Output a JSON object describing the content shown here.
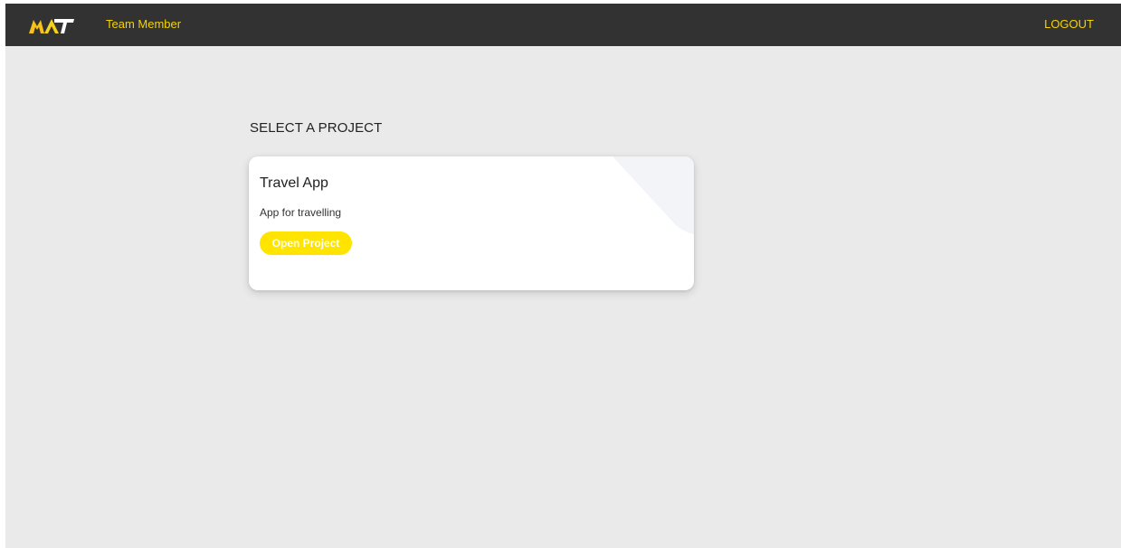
{
  "app": {
    "logo_text": "MAT",
    "role_label": "Team Member",
    "logout_label": "LOGOUT"
  },
  "colors": {
    "navbar_bg": "#323232",
    "accent": "#f5d400",
    "button_bg": "#ffe400",
    "page_bg": "#eaeaea",
    "card_bg": "#ffffff"
  },
  "main": {
    "section_title": "SELECT A PROJECT",
    "projects": [
      {
        "name": "Travel App",
        "description": "App for travelling",
        "open_label": "Open Project"
      }
    ]
  },
  "icons": {
    "logo": "mat-logo-icon",
    "card_decoration": "corner-decoration-icon"
  }
}
